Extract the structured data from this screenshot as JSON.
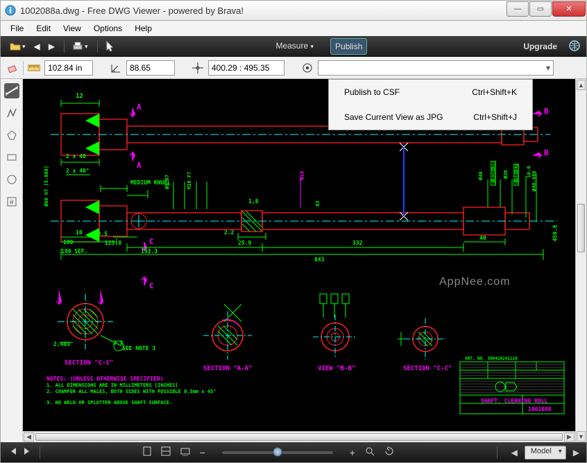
{
  "titlebar": {
    "text": "1002088a.dwg - Free DWG Viewer - powered by Brava!"
  },
  "menubar": {
    "items": [
      "File",
      "Edit",
      "View",
      "Options",
      "Help"
    ]
  },
  "topbar": {
    "measure": "Measure",
    "publish": "Publish",
    "upgrade": "Upgrade"
  },
  "toolbar2": {
    "length_value": "102.84 in",
    "angle_value": "88.65",
    "coord_value": "400.29 : 495.35"
  },
  "popup": {
    "items": [
      {
        "label": "Publish to CSF",
        "shortcut": "Ctrl+Shift+K"
      },
      {
        "label": "Save Current View as JPG",
        "shortcut": "Ctrl+Shift+J"
      }
    ]
  },
  "bottombar": {
    "model": "Model"
  },
  "drawing": {
    "top_dim_12": "12",
    "arrow_B1": "B",
    "arrow_B2": "B",
    "arrow_A1": "A",
    "arrow_A2": "A",
    "arrow_C1": "C",
    "arrow_C2": "C",
    "dim_2x48_1": "2 x 48",
    "dim_2x48_2": "2 x 48°",
    "medium_knurl": "MEDIUM KNURL",
    "dim_10": "10",
    "dim_1_8": "1,8",
    "dim_125_8": "125.8",
    "dim_108_5": "108.5",
    "dim_193_3": "193.3",
    "dim_2_2": "2.2",
    "dim_25_9": "25.9",
    "dim_332": "332",
    "dim_843": "843",
    "dim_190_sef": "190 SEF.",
    "dim_100a": "100",
    "dim_40": "40",
    "dim_459": "459.8",
    "dim_10_0": "10.0",
    "fi_040s": "Ø40",
    "fi_0383b": "Ø 038-3B",
    "fi_38": "Ø38",
    "fi_48_888": "Ø48.888",
    "fi_0188": "Ø18",
    "fi_050h": "Ø 50-17",
    "fi_050h2": "Ø60 h7 [5.008]",
    "dim_03": "03",
    "sec_cc": "SECTION \"C-C\"",
    "sec_aa": "SECTION \"A-A\"",
    "view_bb": "VIEW \"B-B\"",
    "sec_cc2": "SECTION \"C-C\"",
    "dim_2403": "2,403",
    "see_note": "SEE NOTE 3",
    "dim_2_1": "2.1",
    "notes_title": "NOTES: (UNLESS OTHERWISE SPECIFIED)",
    "note1": "1.  ALL DIMENSIONS ARE IN MILLIMETERS [INCHES]",
    "note2": "2.  CHAMFER ALL MALES, BOTH SIDES WITH POSSIBLE 0,5mm x 45°",
    "note3": "3.  NO WELD OR SPLATTER ABOVE SHAFT SURFACE.",
    "title_block_part": "SHAFT, CLEANING ROLL",
    "title_block_num": "1002088",
    "title_block_art": "ART. NO.  300420241120",
    "watermark": "AppNee.com",
    "fi_047": "Ø8 07",
    "fi_11": "M18 F7"
  }
}
